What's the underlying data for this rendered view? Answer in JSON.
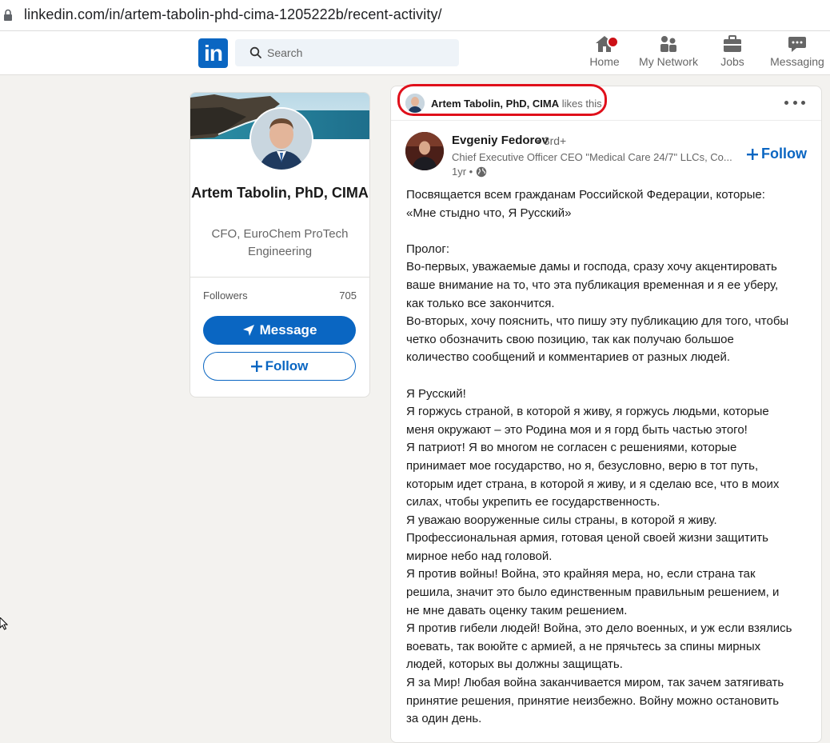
{
  "browser": {
    "url": "linkedin.com/in/artem-tabolin-phd-cima-1205222b/recent-activity/"
  },
  "nav": {
    "logo": "in",
    "search_placeholder": "Search",
    "items": [
      {
        "label": "Home",
        "icon": "home-icon"
      },
      {
        "label": "My Network",
        "icon": "my-network-icon"
      },
      {
        "label": "Jobs",
        "icon": "briefcase-icon"
      },
      {
        "label": "Messaging",
        "icon": "messaging-icon"
      }
    ]
  },
  "profile": {
    "name": "Artem Tabolin, PhD, CIMA",
    "headline": "CFO, EuroChem ProTech Engineering",
    "followers_label": "Followers",
    "followers_count": "705",
    "message_label": "Message",
    "follow_label": "Follow"
  },
  "post": {
    "liker_name": "Artem Tabolin, PhD, CIMA",
    "liker_action": "likes this",
    "author_name": "Evgeniy Fedorov",
    "author_degree": "• 3rd+",
    "author_headline": "Chief Executive Officer CEO \"Medical Care 24/7\" LLCs, Co...",
    "author_time": "1yr •",
    "follow_label": "Follow",
    "lines": [
      "Посвящается всем гражданам Российской Федерации, которые:",
      "«Мне стыдно что, Я Русский»",
      "",
      "Пролог:",
      "Во-первых, уважаемые дамы и господа, сразу хочу акцентировать",
      "ваше внимание на то, что эта публикация временная и я ее уберу,",
      "как только все закончится.",
      "Во-вторых, хочу пояснить, что пишу эту публикацию для того, чтобы",
      "четко обозначить свою позицию, так как получаю большое",
      "количество сообщений и комментариев от разных людей.",
      "",
      "Я Русский!",
      "Я горжусь страной, в которой я живу, я горжусь людьми, которые",
      "меня окружают – это Родина моя и я горд быть частью этого!",
      "Я патриот! Я во многом не согласен с решениями, которые",
      "принимает мое государство, но я, безусловно, верю в тот путь,",
      "которым идет страна, в которой я живу, и я сделаю все, что в моих",
      "силах, чтобы укрепить ее государственность.",
      "Я уважаю вооруженные силы страны, в которой я живу.",
      "Профессиональная армия, готовая ценой своей жизни защитить",
      "мирное небо над головой.",
      "Я против войны! Война, это крайняя мера, но, если страна так",
      "решила, значит это было единственным правильным решением, и",
      "не мне давать оценку таким решением.",
      "Я против гибели людей! Война, это дело военных, и уж если взялись",
      "воевать, так воюйте с армией, а не прячьтесь за спины мирных",
      "людей, которых вы должны защищать.",
      "Я за Мир! Любая война заканчивается миром, так зачем затягивать",
      "принятие решения, принятие неизбежно. Войну можно остановить",
      "за один день."
    ]
  },
  "colors": {
    "brand": "#0a66c2",
    "highlight": "#e0101b",
    "background": "#f3f2ef"
  }
}
